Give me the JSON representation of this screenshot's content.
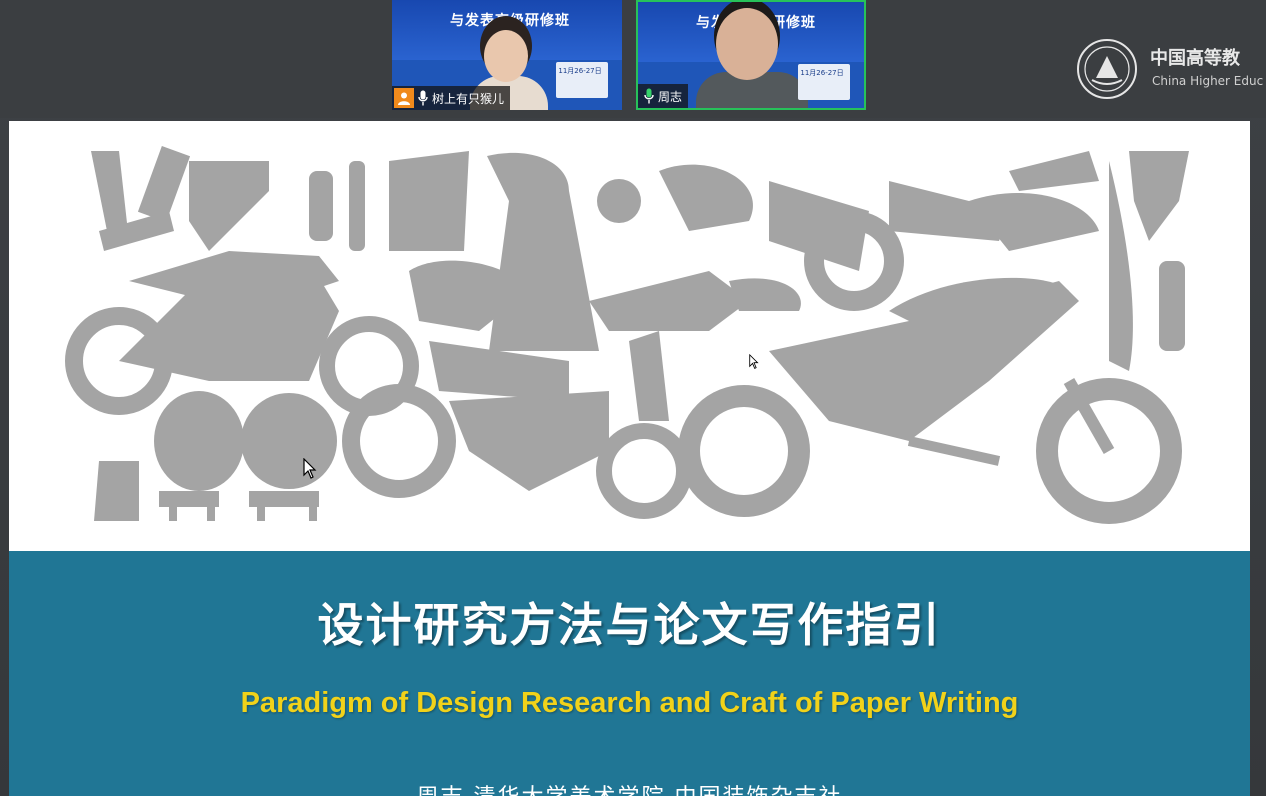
{
  "meeting": {
    "participants": [
      {
        "name": "树上有只猴儿",
        "banner_text": "与发表高级研修班",
        "side_text": "11月26-27日",
        "icon": "person-avatar-icon",
        "mic_icon": "microphone-icon"
      },
      {
        "name": "周志",
        "banner_text": "与发表高级研修班",
        "side_text": "11月26-27日",
        "icon": "none",
        "mic_icon": "microphone-icon"
      }
    ],
    "active_speaker_color": "#27c25a"
  },
  "logo": {
    "name_cn": "中国高等教",
    "name_en": "China Higher Educ",
    "icon": "university-seal-icon"
  },
  "slide": {
    "title_cn": "设计研究方法与论文写作指引",
    "title_en": "Paradigm of Design Research and Craft of Paper Writing",
    "author_line": "周志 清华大学美术学院 中国装饰杂志社",
    "band_color": "#207695",
    "title_en_color": "#f1d21a",
    "collage_color": "#a4a4a4"
  },
  "cursors": [
    {
      "icon": "mouse-pointer-icon"
    },
    {
      "icon": "mouse-pointer-icon"
    }
  ]
}
